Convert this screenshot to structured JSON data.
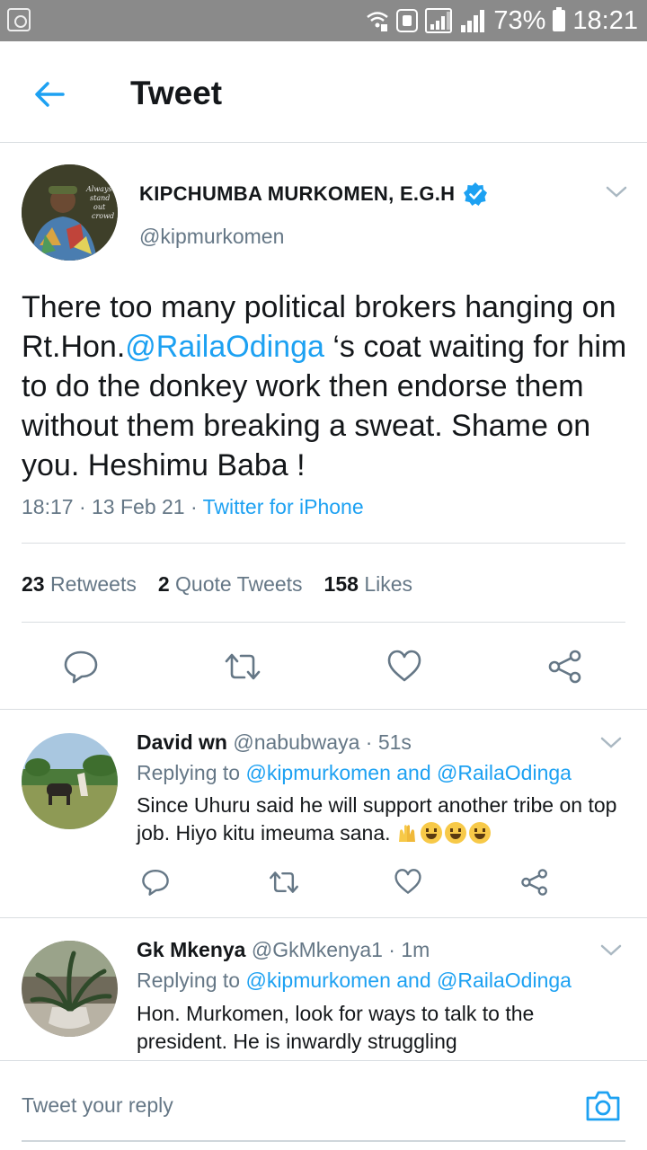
{
  "status_bar": {
    "battery": "73%",
    "time": "18:21",
    "icons": [
      "recycle-icon",
      "wifi-call-icon",
      "call-icon",
      "signal-icon",
      "battery-icon"
    ]
  },
  "header": {
    "title": "Tweet",
    "back_icon": "arrow-left-icon"
  },
  "tweet": {
    "author_name": "KIPCHUMBA MURKOMEN, E.G.H",
    "handle": "@kipmurkomen",
    "verified": true,
    "text_before": "There too many political brokers hanging on Rt.Hon.",
    "mention": "@RailaOdinga",
    "text_after": " ‘s coat waiting for him to do the donkey work then endorse them without  them breaking a sweat. Shame on you. Heshimu Baba !",
    "time": "18:17",
    "date": "13 Feb 21",
    "source": "Twitter for iPhone",
    "stats": {
      "retweets_count": "23",
      "retweets_label": "Retweets",
      "quotes_count": "2",
      "quotes_label": "Quote Tweets",
      "likes_count": "158",
      "likes_label": "Likes"
    }
  },
  "replies": [
    {
      "name": "David wn",
      "handle": "@nabubwaya",
      "age": "51s",
      "replying_prefix": "Replying to",
      "replying_to": "@kipmurkomen and @RailaOdinga",
      "text": "Since Uhuru said he will support another tribe on top job. Hiyo kitu imeuma sana."
    },
    {
      "name": "Gk Mkenya",
      "handle": "@GkMkenya1",
      "age": "1m",
      "replying_prefix": "Replying to",
      "replying_to": "@kipmurkomen and @RailaOdinga",
      "text": "Hon. Murkomen, look for ways to talk to the president. He is inwardly struggling"
    }
  ],
  "compose": {
    "placeholder": "Tweet your reply"
  },
  "colors": {
    "accent": "#1da1f2",
    "secondary_text": "#657786",
    "primary_text": "#14171a",
    "status_bar": "#8a8a8a"
  }
}
